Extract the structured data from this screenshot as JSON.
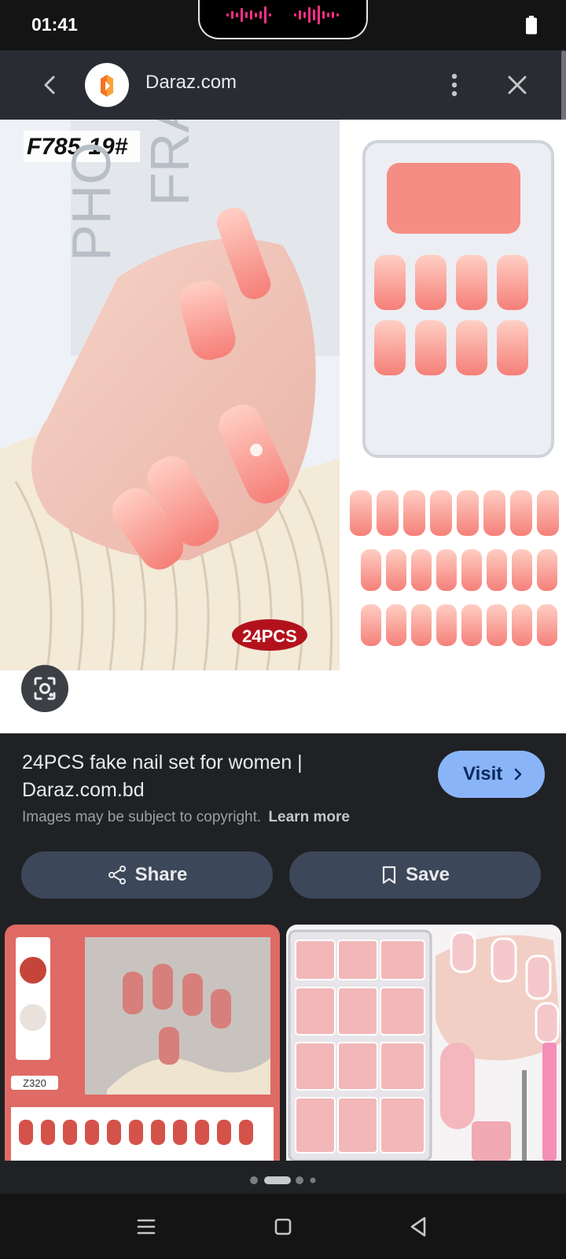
{
  "status_bar": {
    "time": "01:41"
  },
  "app_bar": {
    "site_name": "Daraz.com"
  },
  "hero_image": {
    "code_label": "F785-19#",
    "badge": "24PCS",
    "box_text_1": "PHO",
    "box_text_2": "FRAM"
  },
  "result": {
    "title": "24PCS fake nail set for women | Daraz.com.bd",
    "copyright_text": "Images may be subject to copyright.",
    "learn_more": "Learn more",
    "visit_label": "Visit"
  },
  "actions": {
    "share_label": "Share",
    "save_label": "Save"
  },
  "related": {
    "card1_code": "Z320"
  },
  "pager": {
    "count": 4,
    "active_index": 1
  },
  "colors": {
    "accent": "#8ab4f8",
    "brand_orange": "#f57224",
    "badge_red": "#b3121c"
  },
  "icons": {
    "back": "arrow-left-icon",
    "more": "more-vert-icon",
    "close": "close-icon",
    "lens": "lens-icon",
    "share": "share-icon",
    "save": "bookmark-icon",
    "nav_menu": "menu-icon",
    "nav_home": "home-square-icon",
    "nav_back": "back-triangle-icon"
  }
}
